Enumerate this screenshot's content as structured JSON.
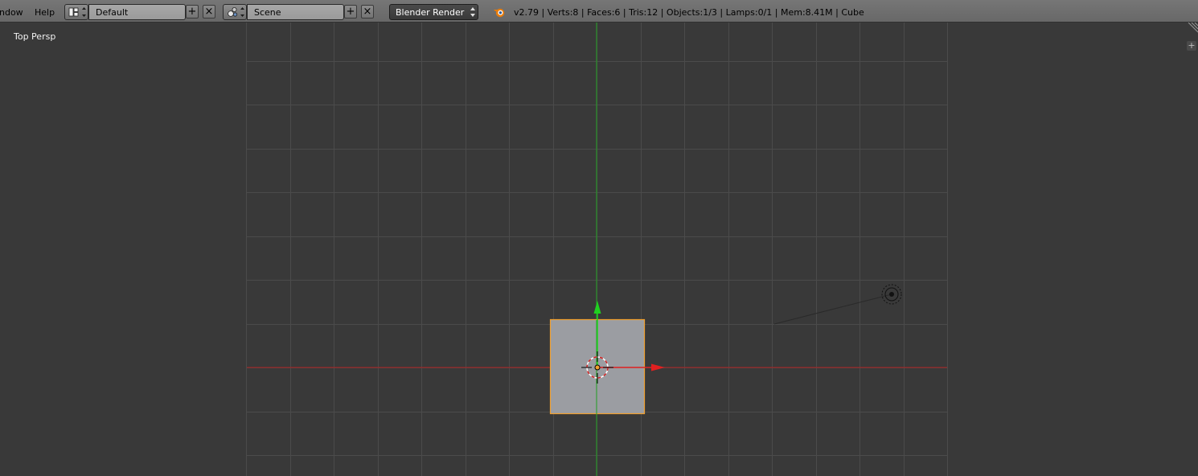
{
  "header": {
    "menu": {
      "window": "ndow",
      "help": "Help"
    },
    "screen_layout": {
      "value": "Default",
      "icon": "screen-layout-icon"
    },
    "scene": {
      "value": "Scene",
      "icon": "scene-icon"
    },
    "render_engine": "Blender Render",
    "stats": "v2.79 | Verts:8 | Faces:6 | Tris:12 | Objects:1/3 | Lamps:0/1 | Mem:8.41M | Cube",
    "icons": {
      "add": "+",
      "remove": "×"
    }
  },
  "viewport": {
    "view_label": "Top Persp",
    "colors": {
      "background": "#393939",
      "grid": "#4b4b4b",
      "x_axis": "#b02020",
      "y_axis": "#22a022",
      "object_fill": "#9b9da2",
      "selection_outline": "#f0a030"
    },
    "selected_object": "Cube",
    "objects": [
      "cube",
      "lamp",
      "3d-cursor"
    ]
  }
}
